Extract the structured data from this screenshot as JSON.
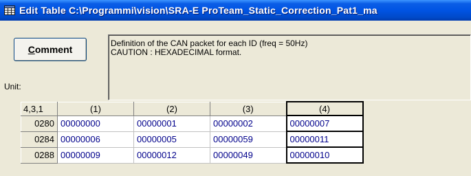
{
  "window": {
    "title": "Edit Table C:\\Programmi\\vision\\SRA-E ProTeam_Static_Correction_Pat1_ma"
  },
  "comment": {
    "button_label_mnemonic": "C",
    "button_label_rest": "omment",
    "text": "Definition of the CAN packet for each ID (freq = 50Hz)\nCAUTION : HEXADECIMAL format."
  },
  "unit": {
    "label": "Unit:"
  },
  "table": {
    "corner": "4,3,1",
    "columns": [
      "(1)",
      "(2)",
      "(3)",
      "(4)"
    ],
    "rows": [
      {
        "id": "0280",
        "cells": [
          "00000000",
          "00000001",
          "00000002",
          "00000007"
        ]
      },
      {
        "id": "0284",
        "cells": [
          "00000006",
          "00000005",
          "00000059",
          "00000011"
        ]
      },
      {
        "id": "0288",
        "cells": [
          "00000009",
          "00000012",
          "00000049",
          "00000010"
        ]
      }
    ],
    "selected_column": 4
  },
  "colors": {
    "titlebar": "#0054e3",
    "cell_text": "#00008b",
    "window_bg": "#ece9d8"
  }
}
